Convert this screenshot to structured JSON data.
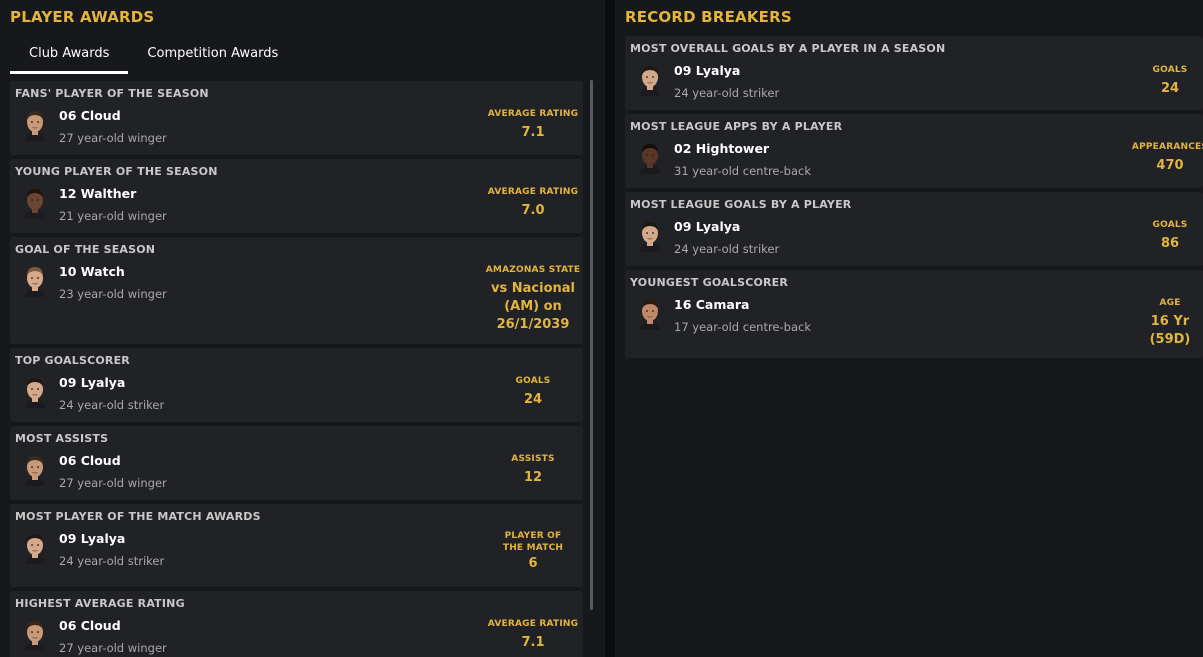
{
  "left_panel": {
    "title": "PLAYER AWARDS",
    "tabs": [
      {
        "label": "Club Awards",
        "active": true
      },
      {
        "label": "Competition Awards",
        "active": false
      }
    ],
    "cards": [
      {
        "title": "FANS' PLAYER OF THE SEASON",
        "name": "06 Cloud",
        "desc": "27 year-old winger",
        "stat_label": "AVERAGE RATING",
        "stat_value": "7.1",
        "skin": "#c99a78",
        "hair": "#3a2a1e"
      },
      {
        "title": "YOUNG PLAYER OF THE SEASON",
        "name": "12 Walther",
        "desc": "21 year-old winger",
        "stat_label": "AVERAGE RATING",
        "stat_value": "7.0",
        "skin": "#6a4532",
        "hair": "#1e140e"
      },
      {
        "title": "GOAL OF THE SEASON",
        "name": "10 Watch",
        "desc": "23 year-old winger",
        "stat_label": "AMAZONAS STATE",
        "stat_value": "vs Nacional (AM) on 26/1/2039",
        "skin": "#d7a88a",
        "hair": "#7a5a3e"
      },
      {
        "title": "TOP GOALSCORER",
        "name": "09 Lyalya",
        "desc": "24 year-old striker",
        "stat_label": "GOALS",
        "stat_value": "24",
        "skin": "#d4a98a",
        "hair": "#1f1813"
      },
      {
        "title": "MOST ASSISTS",
        "name": "06 Cloud",
        "desc": "27 year-old winger",
        "stat_label": "ASSISTS",
        "stat_value": "12",
        "skin": "#c99a78",
        "hair": "#3a2a1e"
      },
      {
        "title": "MOST PLAYER OF THE MATCH AWARDS",
        "name": "09 Lyalya",
        "desc": "24 year-old striker",
        "stat_label": "PLAYER OF THE MATCH",
        "stat_value": "6",
        "skin": "#d4a98a",
        "hair": "#1f1813"
      },
      {
        "title": "HIGHEST AVERAGE RATING",
        "name": "06 Cloud",
        "desc": "27 year-old winger",
        "stat_label": "AVERAGE RATING",
        "stat_value": "7.1",
        "skin": "#c99a78",
        "hair": "#3a2a1e"
      }
    ]
  },
  "right_panel": {
    "title": "RECORD BREAKERS",
    "cards": [
      {
        "title": "MOST OVERALL GOALS BY A PLAYER IN A SEASON",
        "name": "09 Lyalya",
        "desc": "24 year-old striker",
        "stat_label": "GOALS",
        "stat_value": "24",
        "skin": "#d4a98a",
        "hair": "#1f1813"
      },
      {
        "title": "MOST LEAGUE APPS BY A PLAYER",
        "name": "02 Hightower",
        "desc": "31 year-old centre-back",
        "stat_label": "APPEARANCES",
        "stat_value": "470",
        "skin": "#5a3626",
        "hair": "#140d09"
      },
      {
        "title": "MOST LEAGUE GOALS BY A PLAYER",
        "name": "09 Lyalya",
        "desc": "24 year-old striker",
        "stat_label": "GOALS",
        "stat_value": "86",
        "skin": "#d4a98a",
        "hair": "#1f1813"
      },
      {
        "title": "YOUNGEST GOALSCORER",
        "name": "16 Camara",
        "desc": "17 year-old centre-back",
        "stat_label": "AGE",
        "stat_value": "16 Yr (59D)",
        "skin": "#c08a6a",
        "hair": "#2a1a10"
      }
    ]
  },
  "colors": {
    "accent": "#e3b43e",
    "card_bg": "#212226",
    "panel_bg": "#17181c"
  }
}
